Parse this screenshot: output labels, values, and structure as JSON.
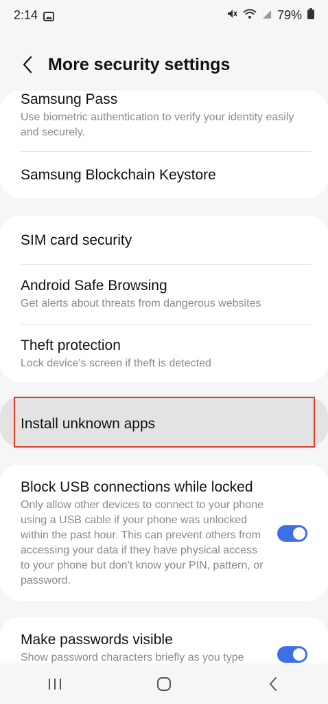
{
  "status_bar": {
    "time": "2:14",
    "battery": "79%",
    "icons": [
      "image-icon",
      "mute-icon",
      "wifi-icon",
      "signal-icon",
      "battery-icon"
    ]
  },
  "header": {
    "title": "More security settings",
    "back_icon": "chevron-left-icon"
  },
  "group1": {
    "samsung_pass_title": "Samsung Pass",
    "samsung_pass_sub": "Use biometric authentication to verify your identity easily and securely.",
    "blockchain_title": "Samsung Blockchain Keystore"
  },
  "group2": {
    "sim_title": "SIM card security",
    "safe_browsing_title": "Android Safe Browsing",
    "safe_browsing_sub": "Get alerts about threats from dangerous websites",
    "theft_title": "Theft protection",
    "theft_sub": "Lock device's screen if theft is detected"
  },
  "group3": {
    "install_unknown_title": "Install unknown apps"
  },
  "group4": {
    "block_usb_title": "Block USB connections while locked",
    "block_usb_sub": "Only allow other devices to connect to your phone using a USB cable if your phone was unlocked within the past hour. This can prevent others from accessing your data if they have physical access to your phone but don't know your PIN, pattern, or password.",
    "block_usb_toggle": "on"
  },
  "group5": {
    "passwords_title": "Make passwords visible",
    "passwords_sub": "Show password characters briefly as you type",
    "passwords_toggle": "on"
  },
  "navbar": {
    "icons": [
      "recents-icon",
      "home-icon",
      "back-icon"
    ]
  },
  "colors": {
    "accent": "#3d6fe6",
    "highlight_border": "#e03a2c",
    "background": "#f6f6f6",
    "card": "#ffffff",
    "secondary_text": "#8a8a8a"
  }
}
